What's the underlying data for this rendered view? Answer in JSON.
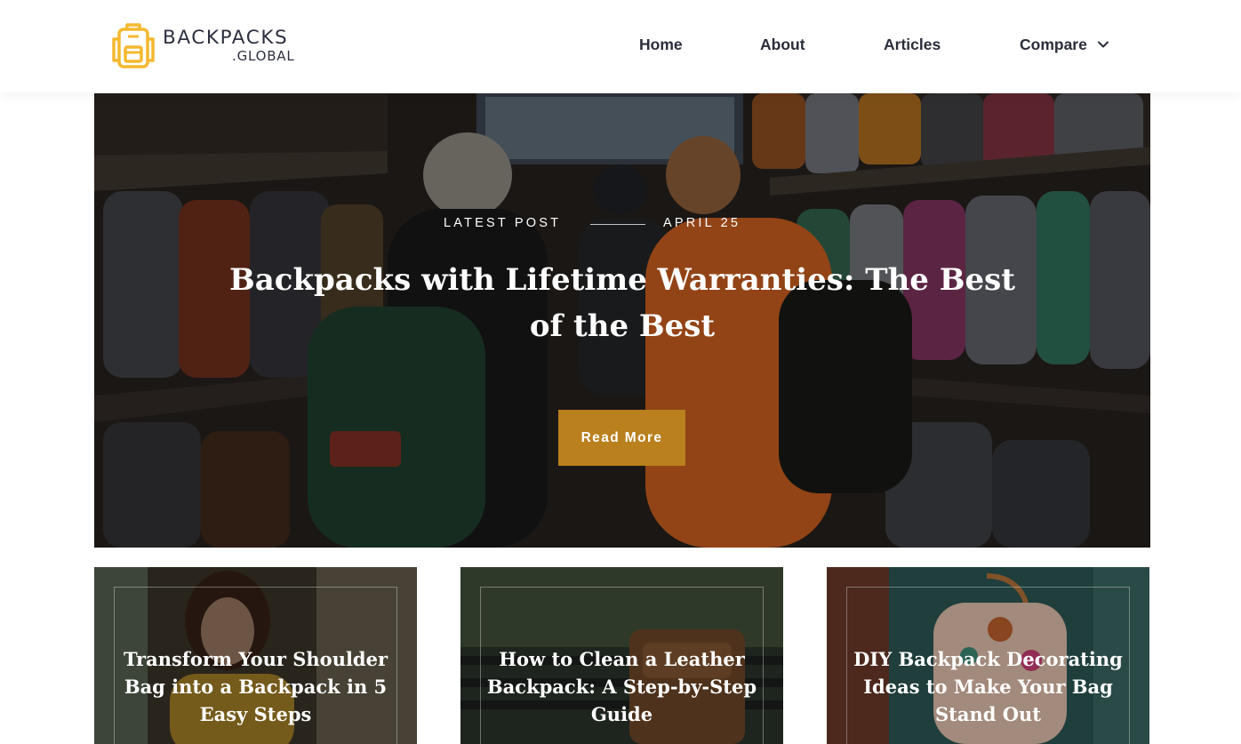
{
  "header": {
    "logo": {
      "brand": "BACKPACKS",
      "domain": ".GLOBAL",
      "accent_color": "#f5b82e"
    },
    "nav": {
      "home": "Home",
      "about": "About",
      "articles": "Articles",
      "compare": "Compare"
    }
  },
  "hero": {
    "label": "LATEST POST",
    "date": "APRIL 25",
    "title": "Backpacks with Lifetime Warranties: The Best of the Best",
    "button": "Read More",
    "button_color": "#b9801d"
  },
  "cards": [
    {
      "title": "Transform Your Shoulder Bag into a Backpack in 5 Easy Steps"
    },
    {
      "title": "How to Clean a Leather Backpack: A Step-by-Step Guide"
    },
    {
      "title": "DIY Backpack Decorating Ideas to Make Your Bag Stand Out"
    }
  ]
}
